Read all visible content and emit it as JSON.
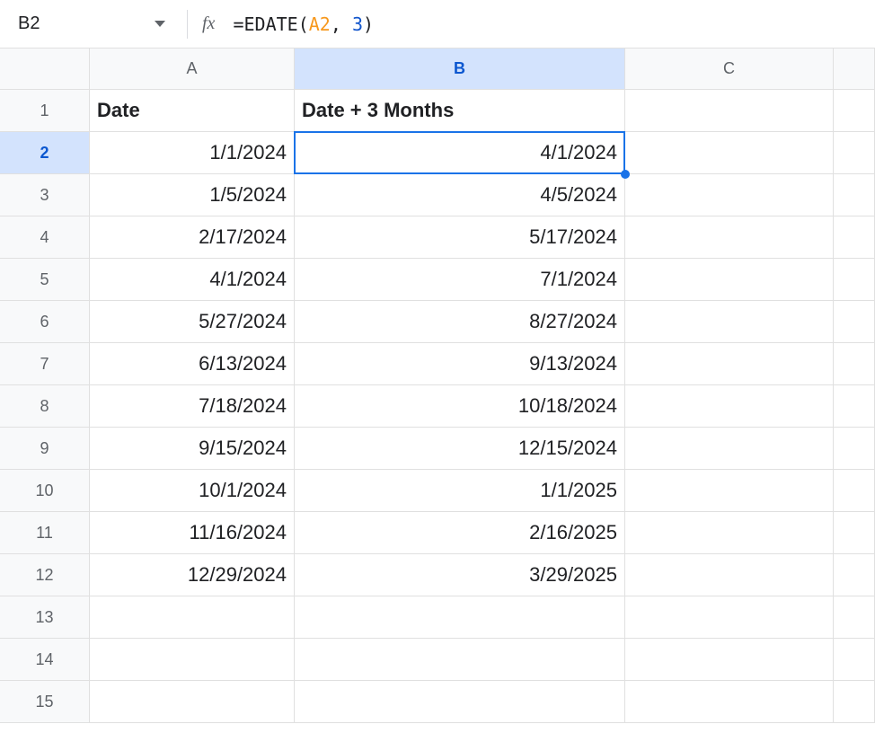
{
  "nameBox": "B2",
  "formula": {
    "prefix": "=",
    "fn": "EDATE",
    "open": "(",
    "ref": "A2",
    "comma": ", ",
    "num": "3",
    "close": ")"
  },
  "fxLabel": "fx",
  "columns": [
    "A",
    "B",
    "C",
    ""
  ],
  "rowNumbers": [
    "1",
    "2",
    "3",
    "4",
    "5",
    "6",
    "7",
    "8",
    "9",
    "10",
    "11",
    "12",
    "13",
    "14",
    "15"
  ],
  "selectedColumn": "B",
  "selectedRow": "2",
  "headers": {
    "A": "Date",
    "B": "Date + 3 Months"
  },
  "rows": [
    {
      "A": "1/1/2024",
      "B": "4/1/2024"
    },
    {
      "A": "1/5/2024",
      "B": "4/5/2024"
    },
    {
      "A": "2/17/2024",
      "B": "5/17/2024"
    },
    {
      "A": "4/1/2024",
      "B": "7/1/2024"
    },
    {
      "A": "5/27/2024",
      "B": "8/27/2024"
    },
    {
      "A": "6/13/2024",
      "B": "9/13/2024"
    },
    {
      "A": "7/18/2024",
      "B": "10/18/2024"
    },
    {
      "A": "9/15/2024",
      "B": "12/15/2024"
    },
    {
      "A": "10/1/2024",
      "B": "1/1/2025"
    },
    {
      "A": "11/16/2024",
      "B": "2/16/2025"
    },
    {
      "A": "12/29/2024",
      "B": "3/29/2025"
    }
  ]
}
